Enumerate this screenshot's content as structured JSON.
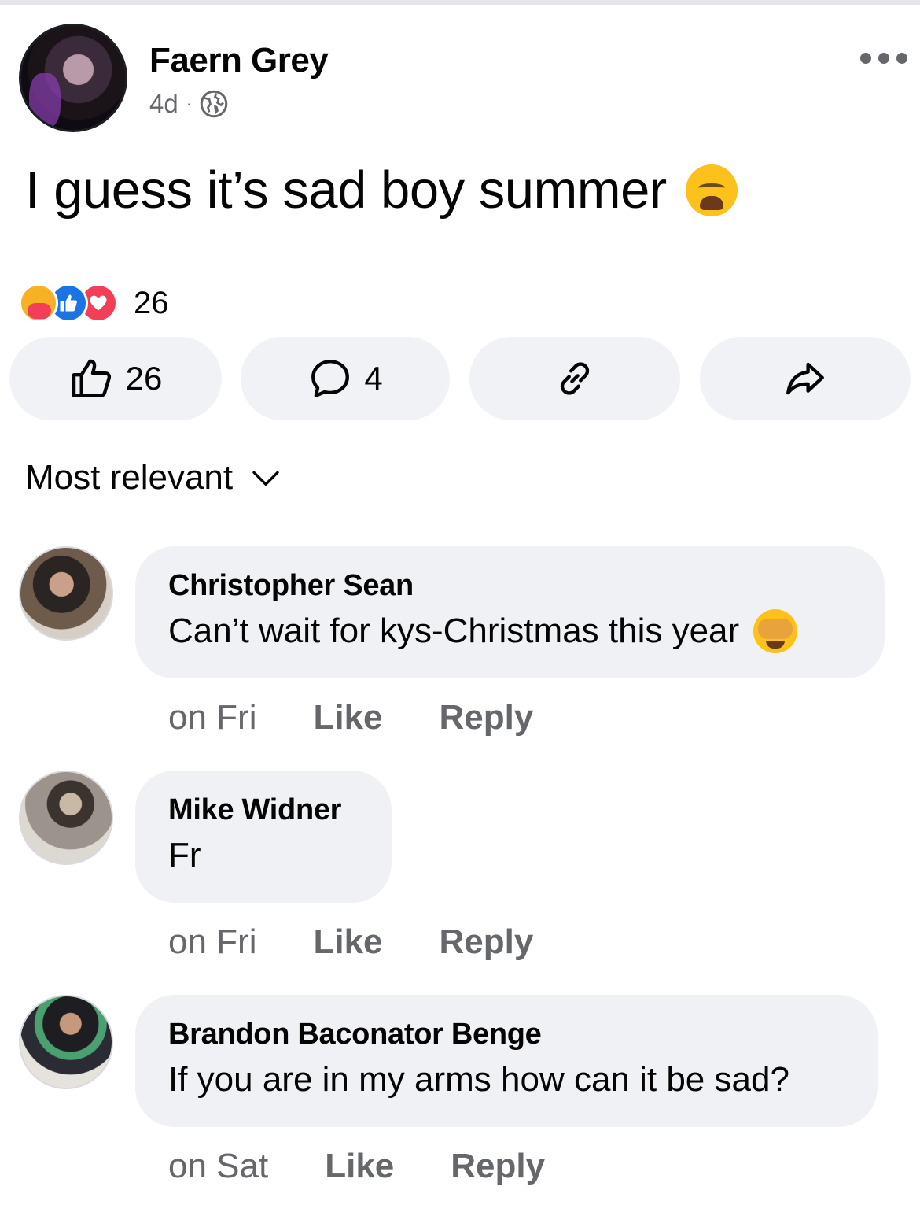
{
  "post": {
    "author": "Faern Grey",
    "time": "4d",
    "separator": "·",
    "privacy_icon": "globe-icon",
    "text": "I guess it’s sad boy summer",
    "text_emoji": "weary-face-emoji"
  },
  "reactions": {
    "icons": [
      "care-reaction-icon",
      "like-reaction-icon",
      "love-reaction-icon"
    ],
    "count": "26"
  },
  "actions": {
    "like_count": "26",
    "comment_count": "4"
  },
  "sort": {
    "label": "Most relevant"
  },
  "comments": [
    {
      "author": "Christopher Sean",
      "text": "Can’t wait for kys-Christmas this year",
      "emoji": "see-no-evil-monkey-emoji",
      "time": "on Fri",
      "like_label": "Like",
      "reply_label": "Reply"
    },
    {
      "author": "Mike Widner",
      "text": "Fr",
      "time": "on Fri",
      "like_label": "Like",
      "reply_label": "Reply"
    },
    {
      "author": "Brandon Baconator Benge",
      "text": "If you are in my arms how can it be sad?",
      "time": "on Sat",
      "like_label": "Like",
      "reply_label": "Reply"
    }
  ],
  "colors": {
    "secondary_text": "#65676b",
    "bubble_bg": "#eff1f4",
    "button_bg": "#f0f2f5",
    "like_blue": "#1b74e4",
    "love_red": "#f33e58"
  }
}
